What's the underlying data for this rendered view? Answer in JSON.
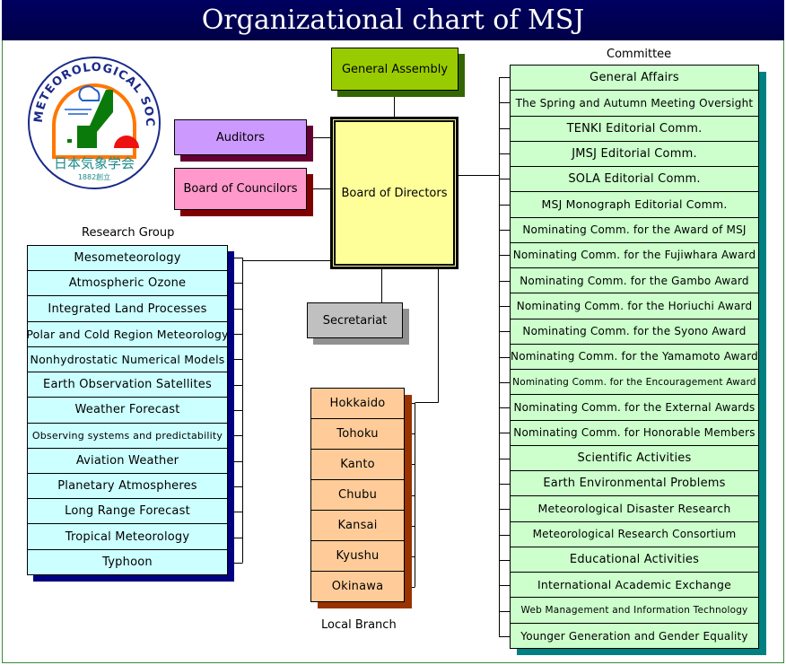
{
  "title": "Organizational chart of MSJ",
  "logo": {
    "ring_text": "METEOROLOGICAL SOCIETY OF JAPAN",
    "jp_name": "日本気象学会",
    "founded": "1882創立"
  },
  "general_assembly": "General Assembly",
  "board": "Board of Directors",
  "auditors": "Auditors",
  "councilors": "Board of Councilors",
  "secretariat": "Secretariat",
  "committee": {
    "heading": "Committee",
    "items": [
      "General Affairs",
      "The Spring and Autumn Meeting Oversight",
      "TENKI Editorial Comm.",
      "JMSJ Editorial Comm.",
      "SOLA Editorial Comm.",
      "MSJ Monograph Editorial Comm.",
      "Nominating Comm. for the Award of MSJ",
      "Nominating Comm. for the Fujiwhara Award",
      "Nominating Comm. for the Gambo Award",
      "Nominating Comm. for the Horiuchi Award",
      "Nominating Comm. for the Syono Award",
      "Nominating Comm. for the Yamamoto Award",
      "Nominating Comm. for the Encouragement Award",
      "Nominating Comm. for the External Awards",
      "Nominating Comm. for Honorable Members",
      "Scientific Activities",
      "Earth Environmental Problems",
      "Meteorological Disaster Research",
      "Meteorological Research Consortium",
      "Educational Activities",
      "International Academic Exchange",
      "Web Management and Information Technology",
      "Younger Generation and Gender Equality"
    ]
  },
  "research": {
    "heading": "Research Group",
    "items": [
      "Mesometeorology",
      "Atmospheric Ozone",
      "Integrated Land Processes",
      "Polar and Cold Region Meteorology",
      "Nonhydrostatic Numerical Models",
      "Earth Observation Satellites",
      "Weather Forecast",
      "Observing systems and predictability",
      "Aviation Weather",
      "Planetary Atmospheres",
      "Long Range Forecast",
      "Tropical Meteorology",
      "Typhoon"
    ]
  },
  "branch": {
    "heading": "Local Branch",
    "items": [
      "Hokkaido",
      "Tohoku",
      "Kanto",
      "Chubu",
      "Kansai",
      "Kyushu",
      "Okinawa"
    ]
  },
  "colors": {
    "title_bg": "#000050",
    "committee": "#ccffcc",
    "committee_shadow": "#008080",
    "research": "#ccffff",
    "research_shadow": "#000080",
    "branch": "#ffcc99",
    "branch_shadow": "#993300",
    "assembly": "#99cc00",
    "board": "#ffff99",
    "auditors": "#cc99ff",
    "councilors": "#ff99cc",
    "secretariat": "#c0c0c0"
  }
}
